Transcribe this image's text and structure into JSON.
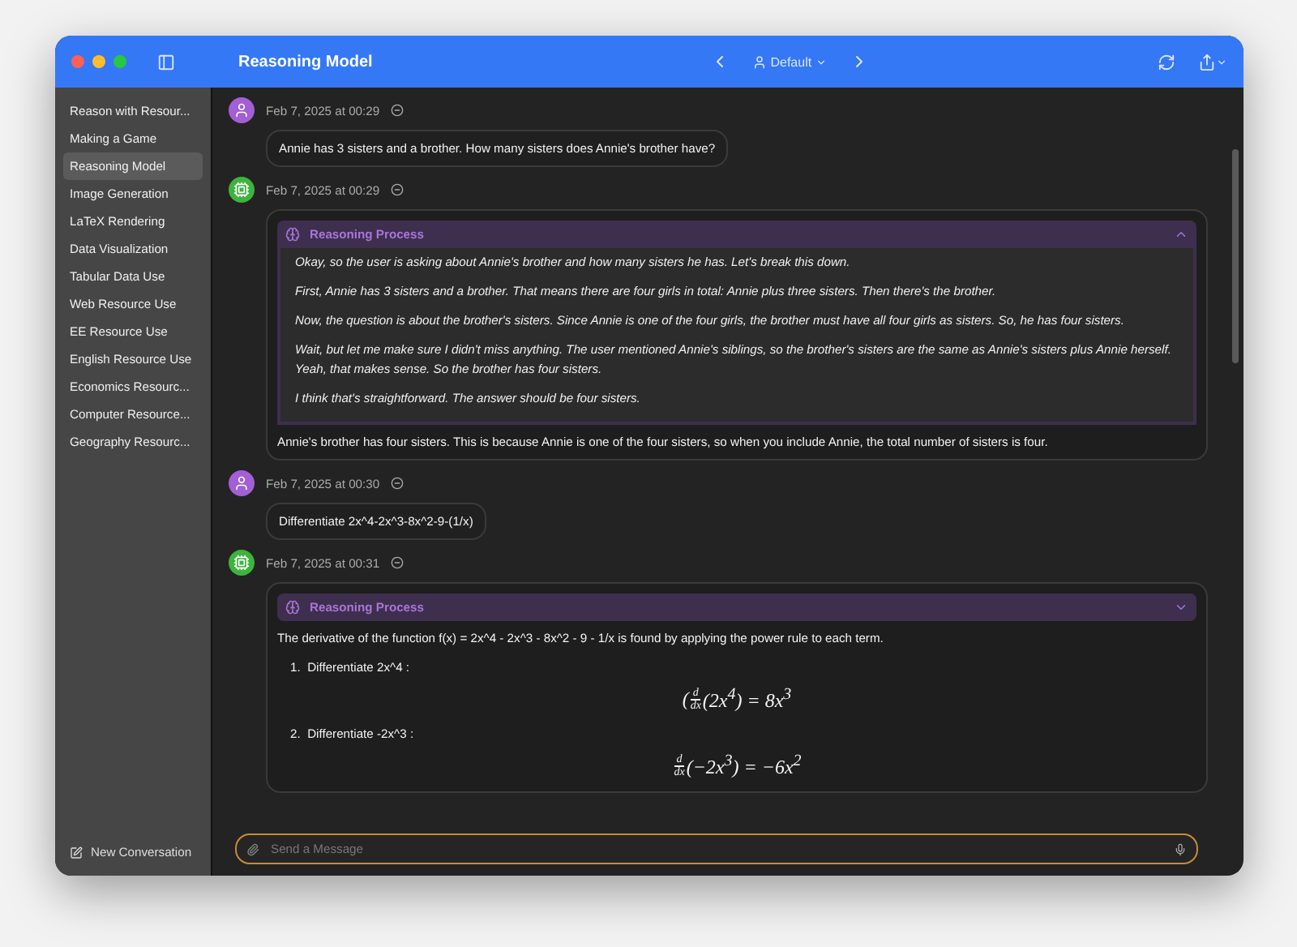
{
  "window": {
    "title": "Reasoning Model",
    "profile": "Default"
  },
  "sidebar": {
    "items": [
      {
        "label": "Reason with Resour...",
        "selected": false
      },
      {
        "label": "Making a Game",
        "selected": false
      },
      {
        "label": "Reasoning Model",
        "selected": true
      },
      {
        "label": "Image Generation",
        "selected": false
      },
      {
        "label": "LaTeX Rendering",
        "selected": false
      },
      {
        "label": "Data Visualization",
        "selected": false
      },
      {
        "label": "Tabular Data Use",
        "selected": false
      },
      {
        "label": "Web Resource Use",
        "selected": false
      },
      {
        "label": "EE Resource Use",
        "selected": false
      },
      {
        "label": "English Resource Use",
        "selected": false
      },
      {
        "label": "Economics Resourc...",
        "selected": false
      },
      {
        "label": "Computer Resource...",
        "selected": false
      },
      {
        "label": "Geography Resourc...",
        "selected": false
      }
    ],
    "new_conversation": "New Conversation"
  },
  "messages": [
    {
      "kind": "user",
      "time": "Feb 7, 2025 at 00:29",
      "text": "Annie has 3 sisters and a brother. How many sisters does Annie's brother have?"
    },
    {
      "kind": "assistant",
      "time": "Feb 7, 2025 at 00:29",
      "reasoning": {
        "title": "Reasoning Process",
        "expanded": true,
        "paragraphs": [
          "Okay, so the user is asking about Annie's brother and how many sisters he has. Let's break this down.",
          "First, Annie has 3 sisters and a brother. That means there are four girls in total: Annie plus three sisters. Then there's the brother.",
          "Now, the question is about the brother's sisters. Since Annie is one of the four girls, the brother must have all four girls as sisters. So, he has four sisters.",
          "Wait, but let me make sure I didn't miss anything. The user mentioned Annie's siblings, so the brother's sisters are the same as Annie's sisters plus Annie herself. Yeah, that makes sense. So the brother has four sisters.",
          "I think that's straightforward. The answer should be four sisters."
        ]
      },
      "answer": "Annie's brother has four sisters. This is because Annie is one of the four sisters, so when you include Annie, the total number of sisters is four."
    },
    {
      "kind": "user",
      "time": "Feb 7, 2025 at 00:30",
      "text": "Differentiate 2x^4-2x^3-8x^2-9-(1/x)"
    },
    {
      "kind": "assistant",
      "time": "Feb 7, 2025 at 00:31",
      "reasoning": {
        "title": "Reasoning Process",
        "expanded": false
      },
      "answer": "The derivative of the function  f(x) = 2x^4 - 2x^3 - 8x^2 - 9 - 1/x is found by applying the power rule to each term.",
      "steps": [
        {
          "number": "1.",
          "text": "Differentiate  2x^4 :",
          "equation": {
            "prefix": "(",
            "num": "d",
            "den": "dx",
            "body": "(2x$^{4}$) = 8x$^{3}$"
          }
        },
        {
          "number": "2.",
          "text": "Differentiate  -2x^3 :",
          "equation": {
            "num": "d",
            "den": "dx",
            "body": "(−2x$^{3}$) = −6x$^{2}$"
          }
        }
      ]
    }
  ],
  "composer": {
    "placeholder": "Send a Message"
  }
}
